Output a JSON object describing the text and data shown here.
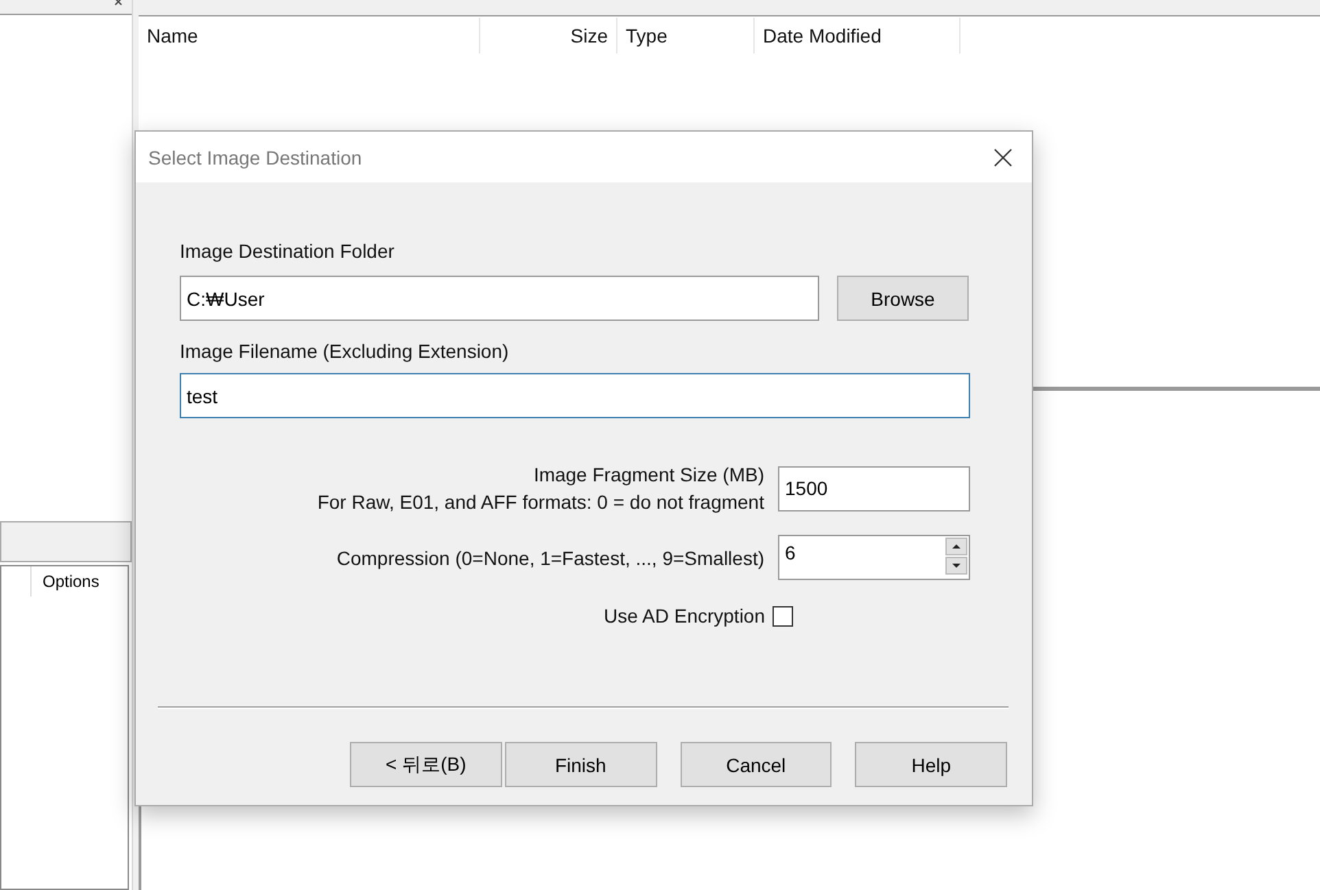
{
  "file_list": {
    "columns": [
      "Name",
      "Size",
      "Type",
      "Date Modified"
    ]
  },
  "properties_panel": {
    "columns": [
      "Options"
    ]
  },
  "dialog": {
    "title": "Select Image Destination",
    "destination_folder": {
      "label": "Image Destination Folder",
      "value": "C:₩User",
      "browse": "Browse"
    },
    "filename": {
      "label": "Image Filename (Excluding Extension)",
      "value": "test"
    },
    "fragment": {
      "label": "Image Fragment Size (MB)",
      "note": "For Raw, E01, and AFF formats: 0 = do not fragment",
      "value": "1500"
    },
    "compression": {
      "label": "Compression (0=None, 1=Fastest, ..., 9=Smallest)",
      "value": "6"
    },
    "encryption": {
      "label": "Use AD Encryption",
      "checked": false
    },
    "buttons": [
      "< 뒤로(B)",
      "Finish",
      "Cancel",
      "Help"
    ]
  }
}
